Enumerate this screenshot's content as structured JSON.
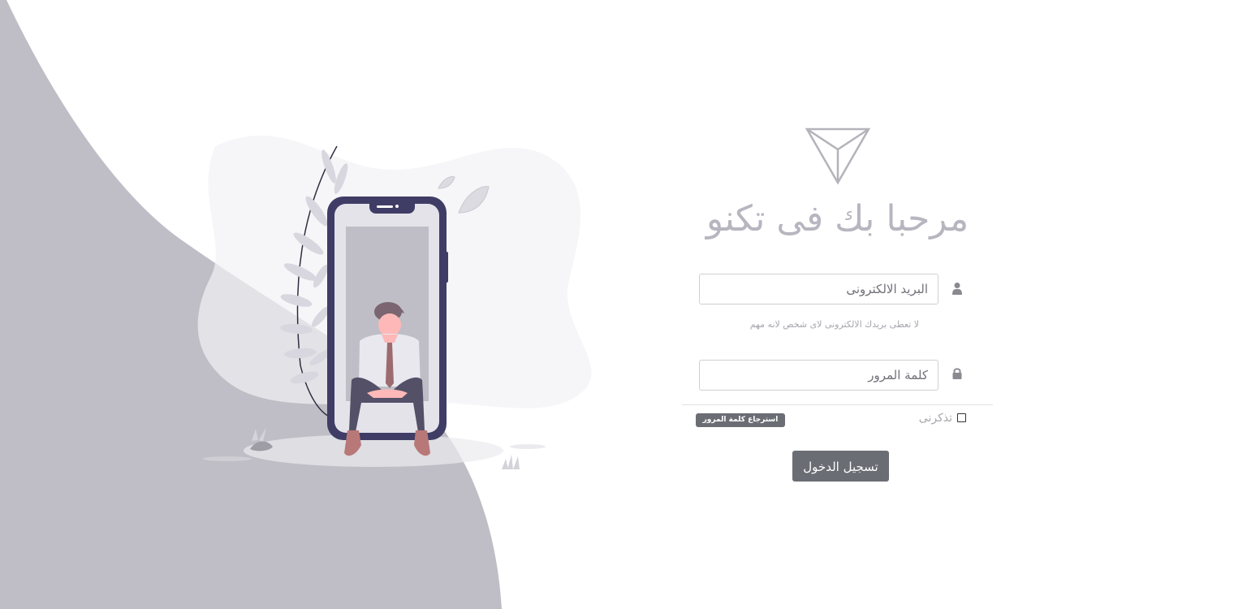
{
  "colors": {
    "accent": "#6b6d74",
    "wave": "#bfbec6",
    "title": "#b7b6c0",
    "phone": "#3f3d66",
    "leaf": "#dcdbe2"
  },
  "login": {
    "title": "مرحبا بك فى تكنو",
    "email_placeholder": "البريد الالكترونى",
    "email_hint": "لا تعطى بريدك الالكترونى لاى شخص لانه مهم",
    "password_placeholder": "كلمة المرور",
    "remember_label": "تذكرنى",
    "recover_label": "استرجاع كلمة المرور",
    "submit_label": "تسجيل الدخول"
  },
  "icons": {
    "logo": "triangle-logo-icon",
    "user": "user-icon",
    "lock": "lock-icon"
  }
}
